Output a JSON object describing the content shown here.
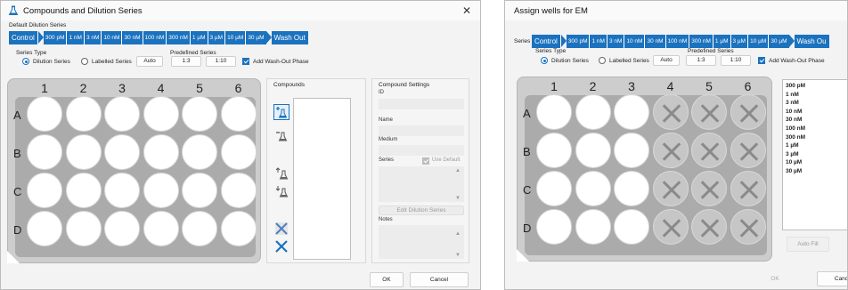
{
  "left_dialog": {
    "title": "Compounds and Dilution Series",
    "close_glyph": "✕",
    "default_dilution_series_label": "Default Dilution Series",
    "series_steps": [
      "Control",
      "300 pM",
      "1 nM",
      "3 nM",
      "10 nM",
      "30 nM",
      "100 nM",
      "300 nM",
      "1 µM",
      "3 µM",
      "10 µM",
      "30 µM",
      "Wash Out"
    ],
    "series_type_label": "Series Type",
    "dilution_series_label": "Dilution Series",
    "labelled_series_label": "Labelled Series",
    "auto_label": "Auto",
    "predefined_series_label": "Predefined Series",
    "ratio_1": "1:3",
    "ratio_2": "1:10",
    "add_washout_label": "Add Wash-Out Phase",
    "columns": [
      "1",
      "2",
      "3",
      "4",
      "5",
      "6"
    ],
    "rows": [
      "A",
      "B",
      "C",
      "D"
    ],
    "compounds_label": "Compounds",
    "compound_settings_label": "Compound Settings",
    "id_label": "ID",
    "name_label": "Name",
    "medium_label": "Medium",
    "series_label": "Series",
    "use_default_label": "Use Default",
    "edit_dilution_series_label": "Edit Dilution Series",
    "notes_label": "Notes",
    "ok_label": "OK",
    "cancel_label": "Cancel"
  },
  "right_dialog": {
    "title": "Assign wells for EM",
    "series_label": "Series",
    "series_steps": [
      "Control",
      "300 pM",
      "1 nM",
      "3 nM",
      "10 nM",
      "30 nM",
      "100 nM",
      "300 nM",
      "1 µM",
      "3 µM",
      "10 µM",
      "30 µM",
      "Wash Ou"
    ],
    "series_type_label": "Series Type",
    "dilution_series_label": "Dilution Series",
    "labelled_series_label": "Labelled Series",
    "auto_label": "Auto",
    "predefined_series_label": "Predefined Series",
    "ratio_1": "1:3",
    "ratio_2": "1:10",
    "add_washout_label": "Add Wash-Out Phase",
    "columns": [
      "1",
      "2",
      "3",
      "4",
      "5",
      "6"
    ],
    "rows": [
      "A",
      "B",
      "C",
      "D"
    ],
    "concentrations": [
      "300 pM",
      "1 nM",
      "3 nM",
      "10 nM",
      "30 nM",
      "100 nM",
      "300 nM",
      "1 µM",
      "3 µM",
      "10 µM",
      "30 µM"
    ],
    "auto_fill_label": "Auto Fill",
    "ok_label": "OK",
    "cancel_label": "Cancel"
  },
  "colors": {
    "accent": "#1b72be",
    "plate": "#cdcdcd",
    "well_disabled": "#c6c6c6"
  },
  "icons": [
    "flask-icon",
    "add-compound-icon",
    "remove-compound-icon",
    "move-up-icon",
    "move-down-icon",
    "clear-wells-icon",
    "delete-icon"
  ]
}
